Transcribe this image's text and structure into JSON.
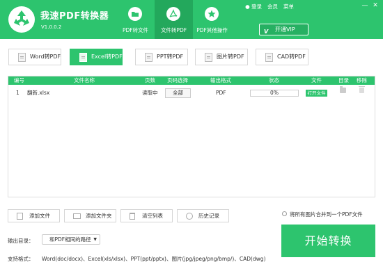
{
  "app": {
    "title": "我速PDF转换器",
    "version": "V1.0.0.2"
  },
  "colors": {
    "brand": "#2dc46e",
    "brand_dark": "#23a85c"
  },
  "top_links": {
    "login": "登录",
    "vip": "会员",
    "menu": "菜单",
    "minimize": "—",
    "close": "✕"
  },
  "nav_tabs": [
    {
      "label": "PDF转文件",
      "icon": "folder-icon"
    },
    {
      "label": "文件转PDF",
      "icon": "pdf-icon"
    },
    {
      "label": "PDF其他操作",
      "icon": "star-icon"
    }
  ],
  "vip_button": {
    "label": "开通VIP",
    "icon": "vip-icon"
  },
  "conversion_tabs": [
    {
      "label": "Word转PDF"
    },
    {
      "label": "Excel转PDF"
    },
    {
      "label": "PPT转PDF"
    },
    {
      "label": "图片转PDF"
    },
    {
      "label": "CAD转PDF"
    }
  ],
  "table": {
    "headers": {
      "index": "编号",
      "name": "文件名称",
      "pages": "页数",
      "page_select": "页码选择",
      "format": "输出格式",
      "status": "状态",
      "file": "文件",
      "dir": "目录",
      "remove": "移除"
    },
    "rows": [
      {
        "index": "1",
        "name": "翻新.xlsx",
        "pages": "读取中",
        "page_select": "全部",
        "format": "PDF",
        "progress": 0,
        "progress_label": "0%",
        "open_label": "打开文件"
      }
    ]
  },
  "toolbar": {
    "add_file": "添加文件",
    "add_folder": "添加文件夹",
    "clear_list": "清空列表",
    "history": "历史记录"
  },
  "merge_option": "将所有图片合并到一个PDF文件",
  "output": {
    "label": "输出目录：",
    "value": "和PDF相同的路径"
  },
  "formats": {
    "label": "支持格式：",
    "text": "Word(doc/docx)、Excel(xls/xlsx)、PPT(ppt/pptx)、图片(jpg/jpeg/png/bmp/)、CAD(dwg)"
  },
  "start_button": "开始转换"
}
